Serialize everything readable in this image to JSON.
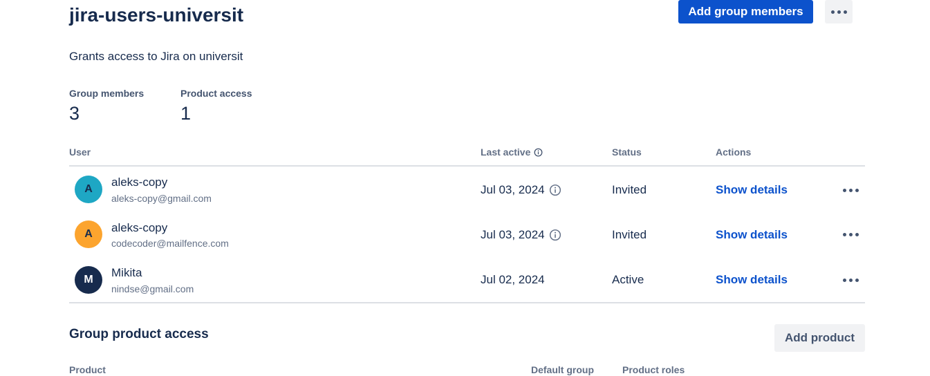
{
  "group": {
    "title": "jira-users-universit",
    "description": "Grants access to Jira on universit",
    "add_members_label": "Add group members"
  },
  "stats": {
    "members_label": "Group members",
    "members_value": "3",
    "product_access_label": "Product access",
    "product_access_value": "1"
  },
  "table": {
    "columns": {
      "user": "User",
      "last_active": "Last active",
      "status": "Status",
      "actions": "Actions"
    },
    "rows": [
      {
        "initial": "A",
        "avatar_color": "#1ea7c4",
        "name": "aleks-copy",
        "email": "aleks-copy@gmail.com",
        "last_active": "Jul 03, 2024",
        "has_info": true,
        "status": "Invited",
        "action": "Show details"
      },
      {
        "initial": "A",
        "avatar_color": "#fca42e",
        "name": "aleks-copy",
        "email": "codecoder@mailfence.com",
        "last_active": "Jul 03, 2024",
        "has_info": true,
        "status": "Invited",
        "action": "Show details"
      },
      {
        "initial": "M",
        "avatar_color": "#172b4d",
        "name": "Mikita",
        "email": "nindse@gmail.com",
        "last_active": "Jul 02, 2024",
        "has_info": false,
        "status": "Active",
        "action": "Show details"
      }
    ]
  },
  "product_access": {
    "title": "Group product access",
    "add_product_label": "Add product",
    "columns": {
      "product": "Product",
      "default_group": "Default group",
      "product_roles": "Product roles"
    }
  },
  "colors": {
    "primary": "#0c52cc",
    "text": "#172b4d",
    "subtle_text": "#626f86"
  },
  "icons": {
    "more": "more-icon",
    "info": "info-icon"
  }
}
